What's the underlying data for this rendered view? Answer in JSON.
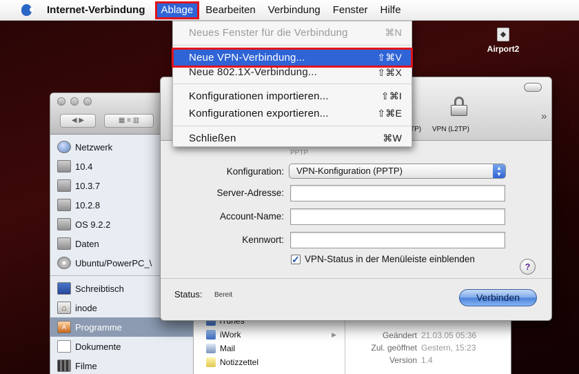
{
  "menubar": {
    "app_name": "Internet-Verbindung",
    "menus": [
      "Ablage",
      "Bearbeiten",
      "Verbindung",
      "Fenster",
      "Hilfe"
    ]
  },
  "dropdown": {
    "items": [
      {
        "label": "Neues Fenster für die Verbindung",
        "shortcut": "⌘N"
      },
      {
        "label": "Neue VPN-Verbindung...",
        "shortcut": "⇧⌘V"
      },
      {
        "label": "Neue 802.1X-Verbindung...",
        "shortcut": "⇧⌘X"
      },
      {
        "label": "Konfigurationen importieren...",
        "shortcut": "⇧⌘I"
      },
      {
        "label": "Konfigurationen exportieren...",
        "shortcut": "⇧⌘E"
      },
      {
        "label": "Schließen",
        "shortcut": "⌘W"
      }
    ]
  },
  "desktop": {
    "airport_label": "Airport2"
  },
  "finder": {
    "sidebar": [
      "Netzwerk",
      "10.4",
      "10.3.7",
      "10.2.8",
      "OS 9.2.2",
      "Daten",
      "Ubuntu/PowerPC_\\",
      "Schreibtisch",
      "inode",
      "Programme",
      "Dokumente",
      "Filme"
    ],
    "apps": [
      "iTunes",
      "iWork",
      "Mail",
      "Notizzettel"
    ],
    "info": [
      {
        "key": "Geändert",
        "value": "21.03.05 05:36"
      },
      {
        "key": "Zul. geöffnet",
        "value": "Gestern, 15:23"
      },
      {
        "key": "Version",
        "value": "1.4"
      }
    ]
  },
  "vpn": {
    "toolbar_cut": "TP)",
    "toolbar_vpn": "VPN (L2TP)",
    "pptp_tag": "PPTP",
    "config_label": "Konfiguration:",
    "config_value": "VPN-Konfiguration (PPTP)",
    "server_label": "Server-Adresse:",
    "account_label": "Account-Name:",
    "password_label": "Kennwort:",
    "show_status_label": "VPN-Status in der Menüleiste einblenden",
    "show_status_checked": true,
    "status_label": "Status:",
    "status_value": "Bereit",
    "connect_label": "Verbinden",
    "help_label": "?"
  }
}
